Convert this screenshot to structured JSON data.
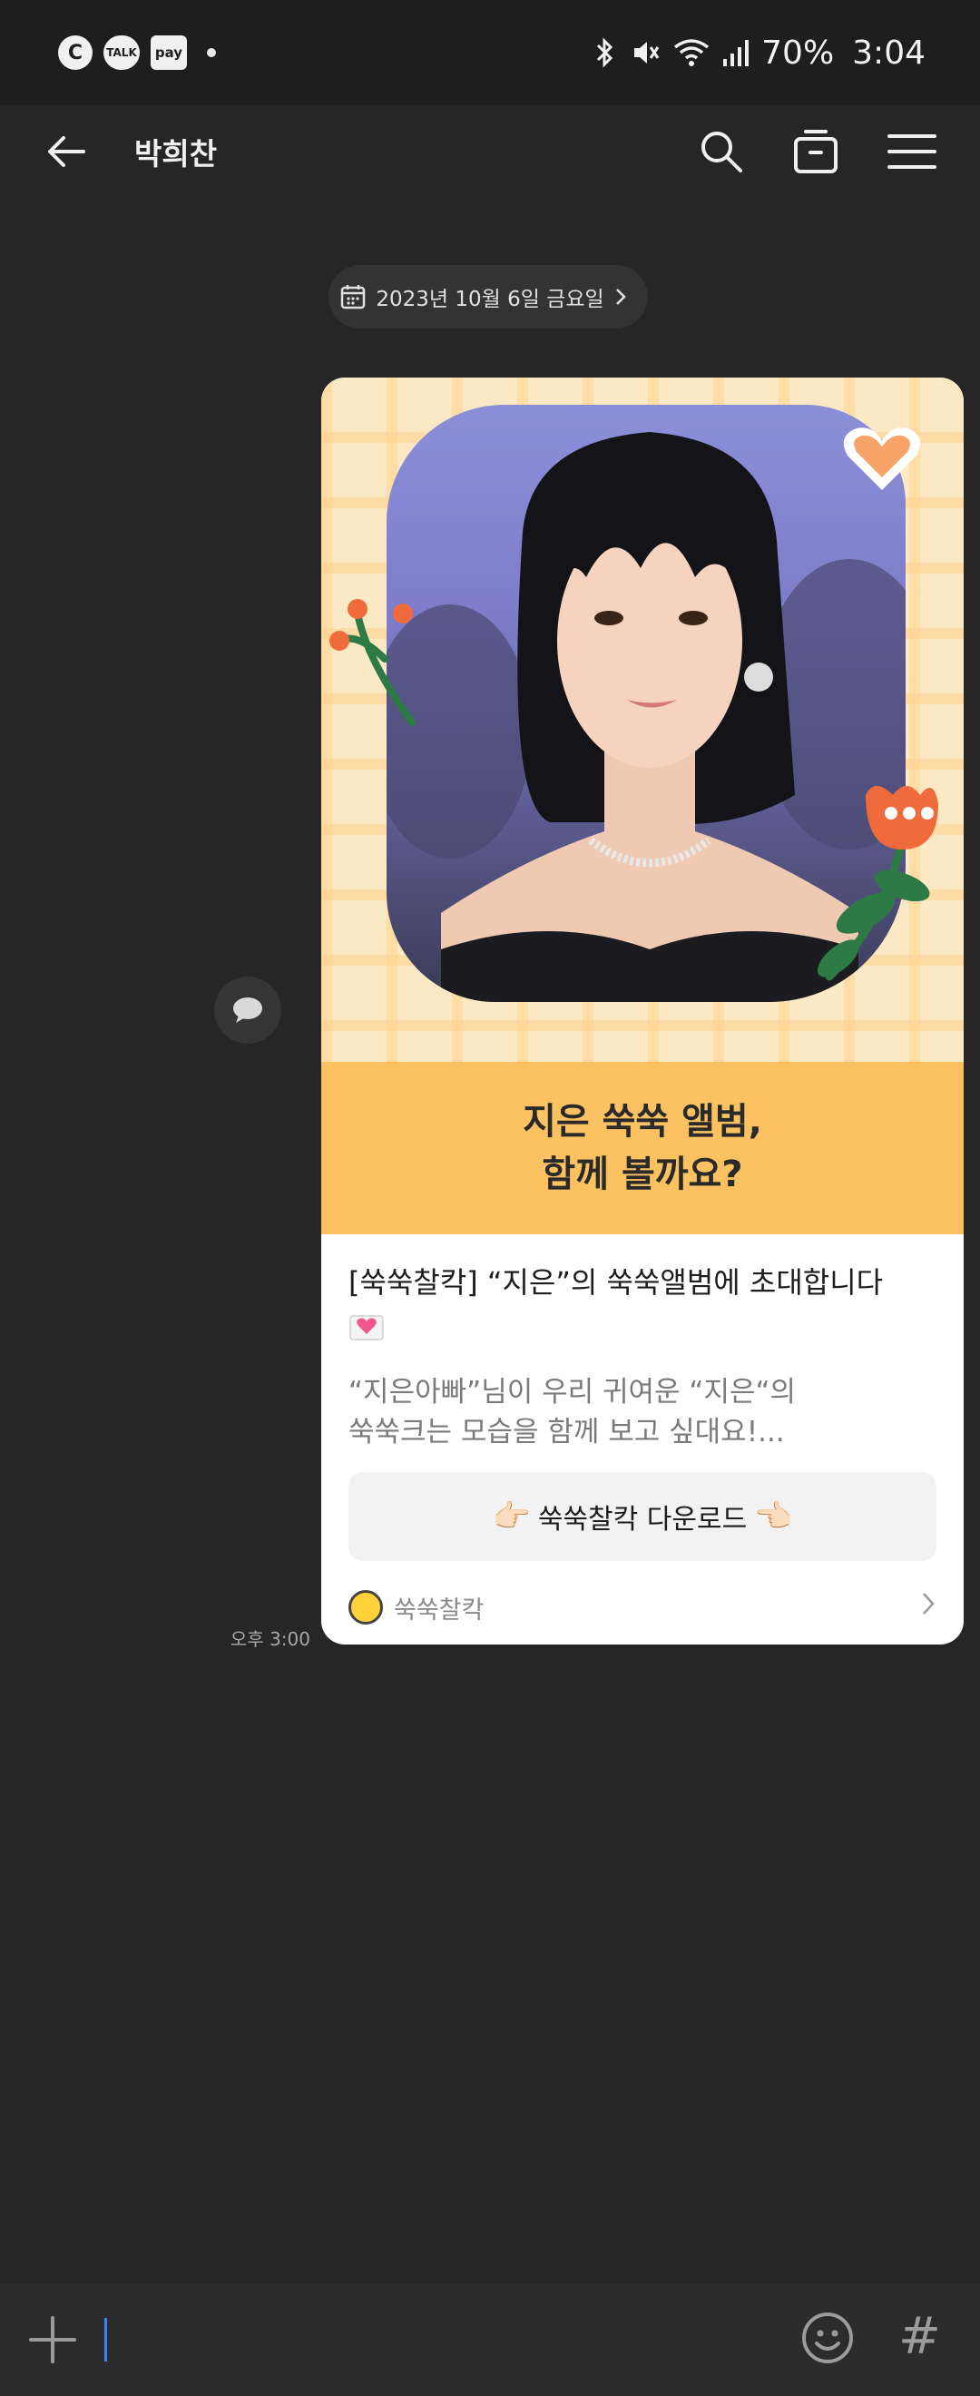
{
  "status_bar": {
    "badges": [
      "C",
      "TALK",
      "pay"
    ],
    "battery": "70%",
    "time": "3:04"
  },
  "header": {
    "title": "박희찬"
  },
  "date_chip": {
    "label": "2023년 10월 6일 금요일"
  },
  "message": {
    "time": "오후 3:00",
    "card": {
      "banner_line1": "지은 쑥쑥 앨범,",
      "banner_line2": "함께 볼까요?",
      "title": "[쑥쑥찰칵] “지은”의 쑥쑥앨범에 초대합니다",
      "desc_line1": "“지은아빠”님이 우리 귀여운 “지은“의",
      "desc_line2": "쑥쑥크는 모습을 함께 보고 싶대요!...",
      "button_label": "쑥쑥찰칵 다운로드",
      "button_left_emoji": "👉🏻",
      "button_right_emoji": "👈🏻",
      "footer_label": "쑥쑥찰칵"
    }
  },
  "colors": {
    "background": "#262626",
    "status_bar": "#1e1e1e",
    "banner": "#fcc262",
    "input_cursor": "#3b82f6"
  }
}
